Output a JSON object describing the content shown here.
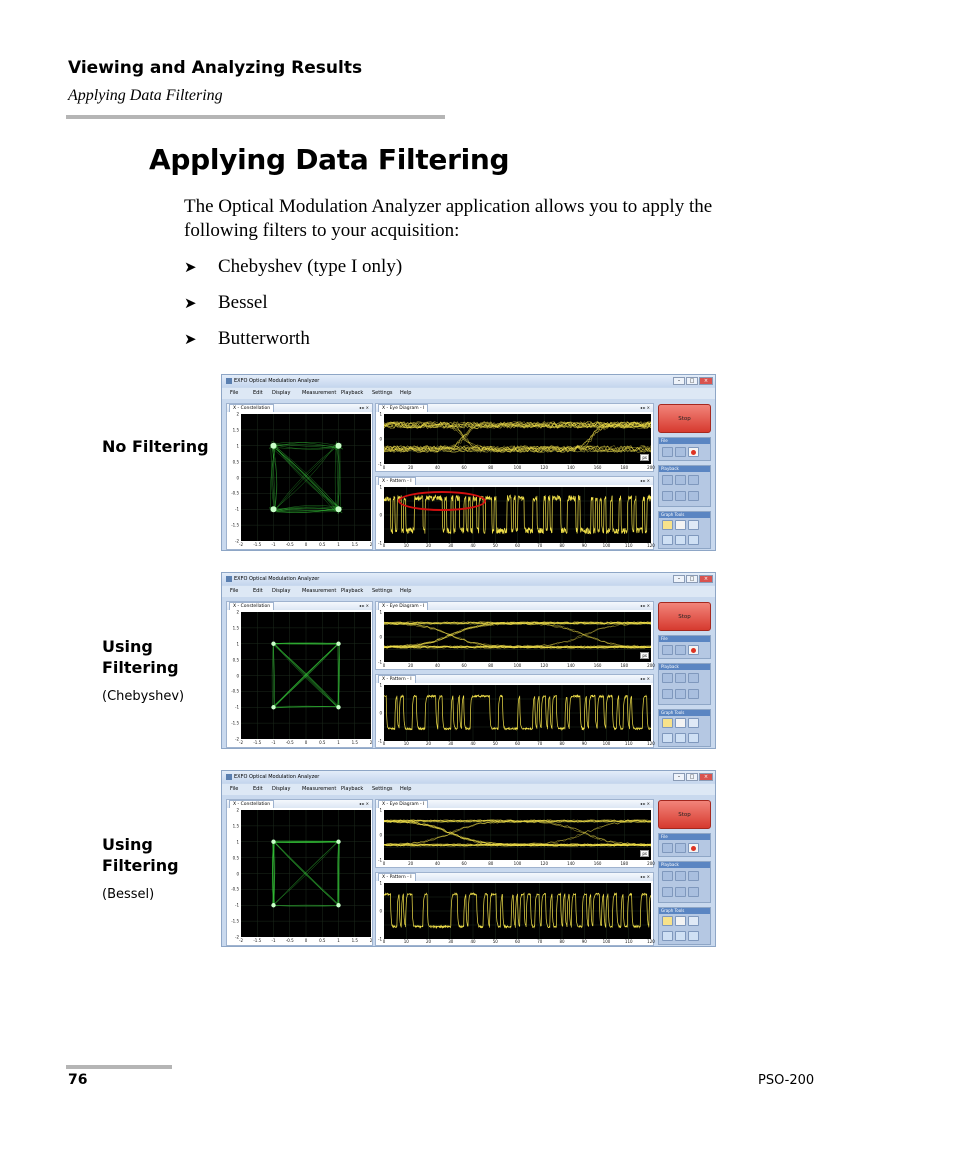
{
  "header": {
    "section_title": "Viewing and Analyzing Results",
    "subsection": "Applying Data Filtering"
  },
  "main": {
    "heading": "Applying Data Filtering",
    "intro": "The Optical Modulation Analyzer application allows you to apply the following filters to your acquisition:",
    "bullet_glyph": "➤",
    "filters": [
      "Chebyshev (type I only)",
      "Bessel",
      "Butterworth"
    ]
  },
  "figures": [
    {
      "label_line1": "No Filtering",
      "label_line2": "",
      "note": ""
    },
    {
      "label_line1": "Using",
      "label_line2": "Filtering",
      "note": "(Chebyshev)"
    },
    {
      "label_line1": "Using",
      "label_line2": "Filtering",
      "note": "(Bessel)"
    }
  ],
  "app": {
    "window_title": "EXFO Optical Modulation Analyzer",
    "menu": [
      "File",
      "Edit",
      "Display",
      "Measurement",
      "Playback",
      "Settings",
      "Help"
    ],
    "constellation_tab": "X - Constellation",
    "eye_tab": "X - Eye Diagram - I",
    "pattern_tab": "X - Pattern - I",
    "stop_label": "Stop",
    "file_group": "File",
    "playback_group": "Playback",
    "graph_tools_group": "Graph Tools",
    "constellation_y_ticks": [
      "2",
      "1.5",
      "1",
      "0.5",
      "0",
      "-0.5",
      "-1",
      "-1.5",
      "-2"
    ],
    "constellation_x_ticks": [
      "-2",
      "-1.5",
      "-1",
      "-0.5",
      "0",
      "0.5",
      "1",
      "1.5",
      "2"
    ],
    "eye_y_ticks": [
      "1",
      "0",
      "-1"
    ],
    "eye_x_ticks": [
      "0",
      "20",
      "40",
      "60",
      "80",
      "100",
      "120",
      "140",
      "160",
      "180",
      "200"
    ],
    "eye_unit": "ps",
    "pattern_y_ticks": [
      "1",
      "0",
      "-1"
    ],
    "pattern_x_ticks": [
      "0",
      "10",
      "20",
      "30",
      "40",
      "50",
      "60",
      "70",
      "80",
      "90",
      "100",
      "110",
      "120"
    ],
    "trace_color": "#f2e14a",
    "constellation_color": "#37d13c",
    "highlight_color": "#d20f0f"
  },
  "footer": {
    "page_number": "76",
    "doc_id": "PSO-200"
  }
}
